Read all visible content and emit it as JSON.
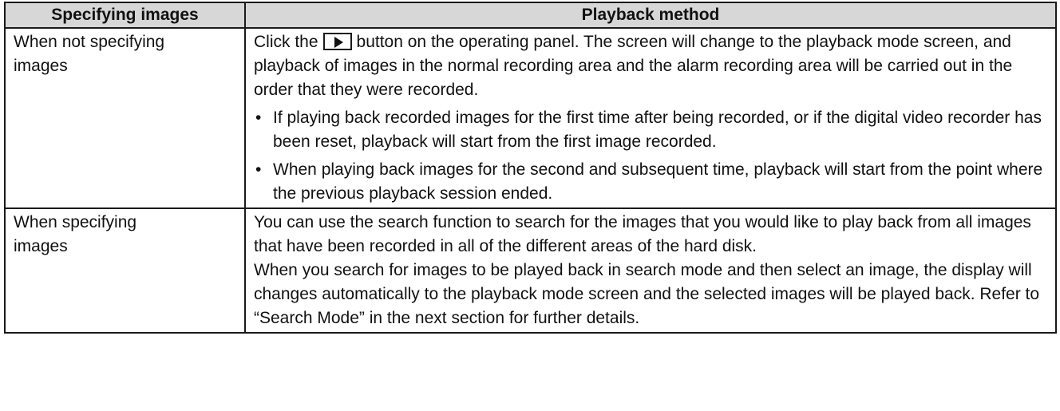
{
  "table": {
    "headers": {
      "col1": "Specifying images",
      "col2": "Playback method"
    },
    "rows": [
      {
        "spec": "When not specifying\nimages",
        "intro_before_button": "Click the",
        "button_icon": "play-icon",
        "intro_after_button": "button on the operating panel. The screen will change to the playback mode screen, and playback of images in the normal recording area and the alarm recording area will be carried out in the order that they were recorded.",
        "bullets": [
          "If playing back recorded images for the first time after being recorded, or if the digital video recorder has been reset, playback will start from the first image recorded.",
          "When playing back images for the second and subsequent time, playback will start from the point where the previous playback session ended."
        ]
      },
      {
        "spec": "When specifying\nimages",
        "para1": "You can use the search function to search for the images that you would like to play back from all images that have been recorded in all of the different areas of the hard disk.",
        "para2": "When you search for images to be played back in search mode and then select an image, the display will changes automatically to the playback mode screen and the selected images will be played back. Refer to “Search Mode” in the next section for further details."
      }
    ],
    "bullet_glyph": "•"
  }
}
